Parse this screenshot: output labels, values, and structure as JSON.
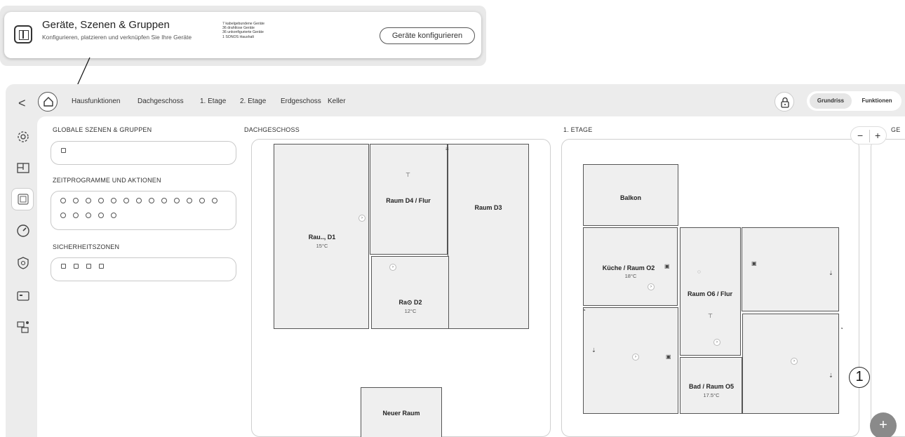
{
  "callout": {
    "title": "Geräte, Szenen & Gruppen",
    "description": "Konfigurieren, platzieren und verknüpfen Sie Ihre Geräte",
    "stats": [
      "7 kabelgebundene Geräte",
      "36 drahtlose Geräte",
      "36 unkonfigurierte Geräte",
      "1 SONOS Haushalt"
    ],
    "button_label": "Geräte konfigurieren"
  },
  "header": {
    "back_glyph": "<",
    "tabs": [
      "Hausfunktionen",
      "Dachgeschoss",
      "1. Etage",
      "2. Etage",
      "Erdgeschoss",
      "Keller"
    ],
    "view_options": [
      "Grundriss",
      "Funktionen"
    ],
    "active_view": "Grundriss"
  },
  "left_panel": {
    "scenes_title": "GLOBALE SZENEN & GRUPPEN",
    "schedules_title": "ZEITPROGRAMME UND AKTIONEN",
    "security_title": "SICHERHEITSZONEN"
  },
  "floors": {
    "dachgeschoss": {
      "title": "DACHGESCHOSS",
      "rooms": {
        "d1": {
          "name": "Rau.., D1",
          "temp": "15°C"
        },
        "d4": {
          "name": "Raum D4 / Flur"
        },
        "d3": {
          "name": "Raum D3"
        },
        "d2": {
          "name": "Ra⊙ D2",
          "temp": "12°C"
        },
        "neu": {
          "name": "Neuer Raum"
        }
      }
    },
    "etage1": {
      "title": "1. ETAGE",
      "rooms": {
        "balkon": {
          "name": "Balkon"
        },
        "kueche": {
          "name": "Küche / Raum O2",
          "temp": "18°C"
        },
        "o6": {
          "name": "Raum O6 / Flur"
        },
        "bad": {
          "name": "Bad / Raum O5",
          "temp": "17.5°C"
        }
      }
    },
    "partial_title": "GE"
  },
  "zoom": {
    "minus": "−",
    "plus": "+"
  },
  "fab_label": "+",
  "marker_label": "1",
  "icons": {
    "rail": [
      "gear-icon",
      "floorplan-icon",
      "devices-icon",
      "gauge-icon",
      "shield-icon",
      "display-icon",
      "network-icon"
    ],
    "lock": "lock-icon",
    "home": "home-icon"
  }
}
